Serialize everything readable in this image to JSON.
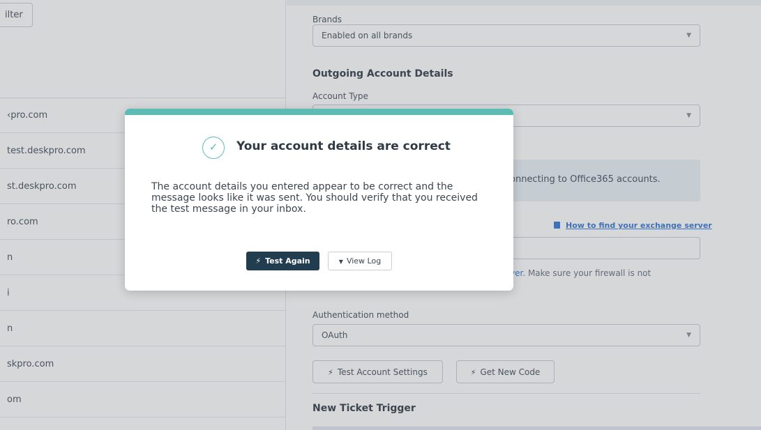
{
  "left_panel": {
    "filter_label": "ilter",
    "accounts": [
      {
        "label": "‹pro.com"
      },
      {
        "label": "test.deskpro.com"
      },
      {
        "label": "st.deskpro.com"
      },
      {
        "label": "ro.com"
      },
      {
        "label": "n"
      },
      {
        "label": "i"
      },
      {
        "label": "n"
      },
      {
        "label": "skpro.com"
      },
      {
        "label": "om"
      }
    ]
  },
  "form": {
    "brands_label": "Brands",
    "brands_value": "Enabled on all brands",
    "outgoing_title": "Outgoing Account Details",
    "account_type_label": "Account Type",
    "info_text": "onnecting to Office365 accounts.",
    "help_link": "How to find your exchange server",
    "hint_link": "ver",
    "hint_text": ". Make sure your firewall is not",
    "auth_label": "Authentication method",
    "auth_value": "OAuth",
    "test_settings_label": "Test Account Settings",
    "get_code_label": "Get New Code",
    "trigger_title": "New Ticket Trigger"
  },
  "modal": {
    "title": "Your account details are correct",
    "body": "The account details you entered appear to be correct and the message looks like it was sent. You should verify that you received the test message in your inbox.",
    "test_again_label": "Test Again",
    "view_log_label": "View Log"
  },
  "colors": {
    "accent": "#5bbcb5",
    "primary_button": "#223c50",
    "link": "#3b7dd8",
    "info_bg": "#e9f1f7"
  }
}
